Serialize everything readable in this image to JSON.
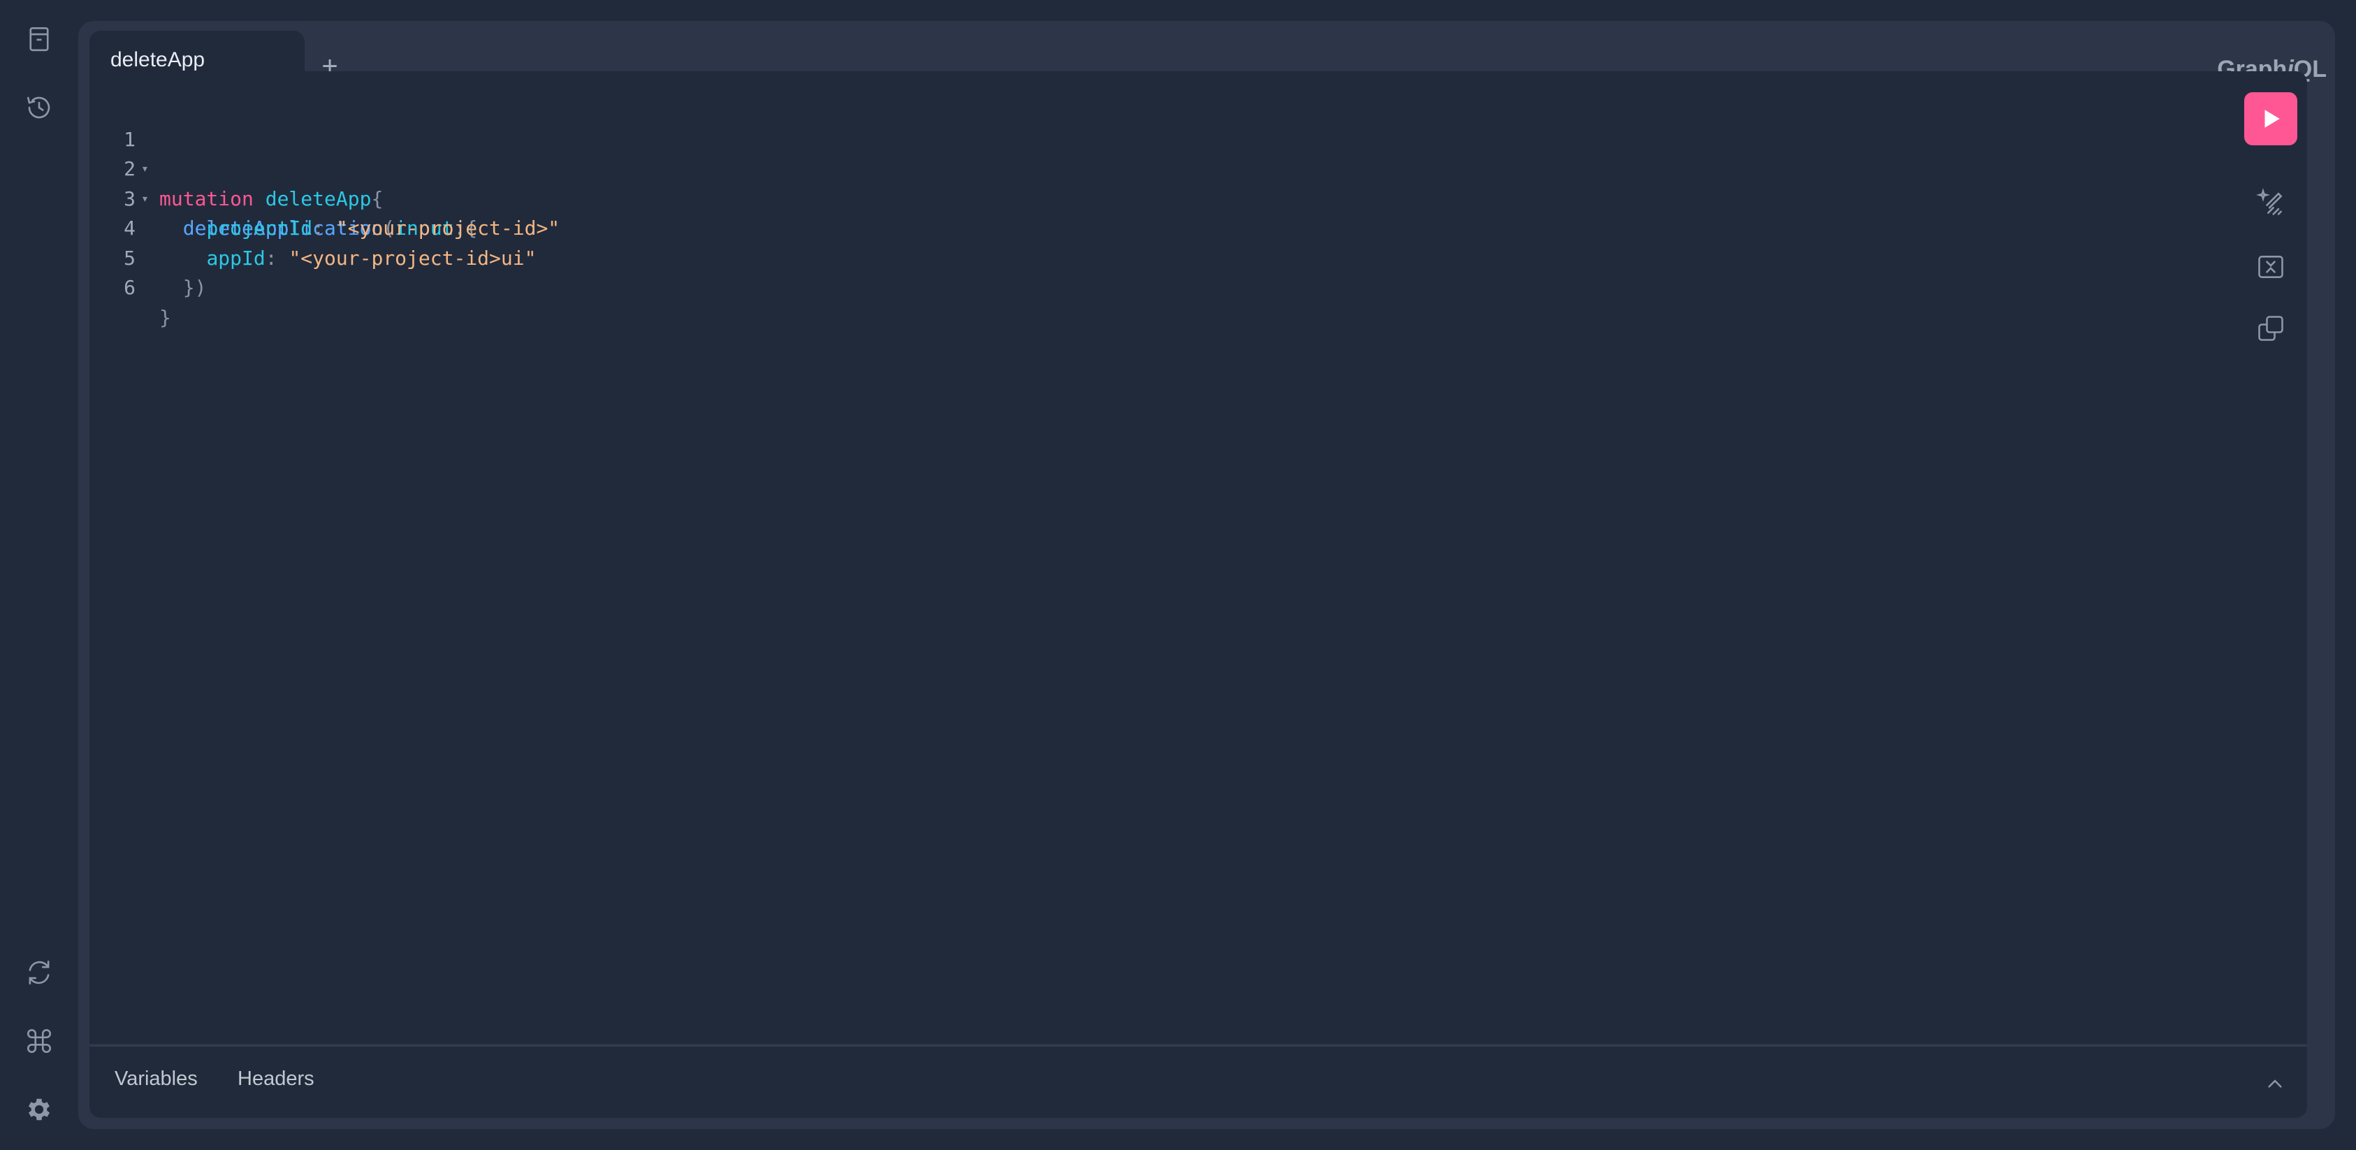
{
  "app": {
    "logo_prefix": "Graph",
    "logo_italic": "i",
    "logo_suffix": "QL"
  },
  "sidebar": {
    "top_icons": [
      "doc-explorer-icon",
      "history-icon"
    ],
    "bottom_icons": [
      "refetch-schema-icon",
      "shortcut-icon",
      "settings-icon"
    ]
  },
  "tabs": [
    {
      "label": "deleteApp"
    }
  ],
  "add_tab_label": "+",
  "editor": {
    "lines": [
      {
        "num": "1",
        "fold": "▾"
      },
      {
        "num": "2",
        "fold": "▾"
      },
      {
        "num": "3",
        "fold": ""
      },
      {
        "num": "4",
        "fold": ""
      },
      {
        "num": "5",
        "fold": ""
      },
      {
        "num": "6",
        "fold": ""
      }
    ],
    "tokens": {
      "l1_kw": "mutation",
      "l1_name": "deleteApp",
      "l1_brace": "{",
      "l2_field": "deleteApplication",
      "l2_paren": "(",
      "l2_arg": "input",
      "l2_colon": ":{",
      "l3_key": "projectId",
      "l3_colon": ":",
      "l3_val": "\"<your-project-id>\"",
      "l4_key": "appId",
      "l4_colon": ":",
      "l4_val": "\"<your-project-id>ui\"",
      "l5_close": "})",
      "l6_close": "}"
    }
  },
  "toolbar": {
    "run": "play-icon",
    "prettify": "prettify-icon",
    "merge": "merge-fragments-icon",
    "copy": "copy-icon"
  },
  "bottom": {
    "variables_label": "Variables",
    "headers_label": "Headers"
  },
  "colors": {
    "background": "#212a3b",
    "frame": "#2d3548",
    "accent": "#ff5794",
    "keyword": "#ff5794",
    "definition": "#2bc8e4",
    "field": "#58a6ff",
    "string": "#f4b682"
  }
}
